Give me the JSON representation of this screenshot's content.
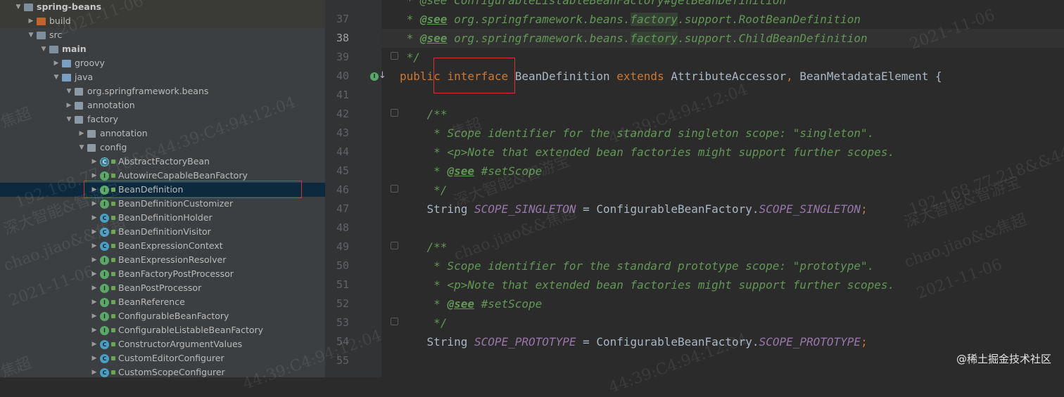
{
  "project_tree": {
    "rows": [
      {
        "label": "spring-beans",
        "icon": "module-icon",
        "expanded": true,
        "bold": true
      },
      {
        "label": "build",
        "icon": "folder-orange-icon",
        "expanded": false,
        "bold": false
      },
      {
        "label": "src",
        "icon": "folder-icon",
        "expanded": true,
        "bold": false
      },
      {
        "label": "main",
        "icon": "folder-icon",
        "expanded": true,
        "bold": true
      },
      {
        "label": "groovy",
        "icon": "folder-blue-icon",
        "expanded": false,
        "bold": false
      },
      {
        "label": "java",
        "icon": "folder-blue-icon",
        "expanded": true,
        "bold": false
      },
      {
        "label": "org.springframework.beans",
        "icon": "package-icon",
        "expanded": true,
        "bold": false
      },
      {
        "label": "annotation",
        "icon": "package-icon",
        "expanded": false,
        "bold": false
      },
      {
        "label": "factory",
        "icon": "package-icon",
        "expanded": true,
        "bold": false
      },
      {
        "label": "annotation",
        "icon": "package-icon",
        "expanded": false,
        "bold": false
      },
      {
        "label": "config",
        "icon": "package-icon",
        "expanded": true,
        "bold": false
      },
      {
        "label": "AbstractFactoryBean",
        "icon": "abstract-class-icon",
        "expanded": false,
        "bold": false
      },
      {
        "label": "AutowireCapableBeanFactory",
        "icon": "interface-icon",
        "expanded": false,
        "bold": false
      },
      {
        "label": "BeanDefinition",
        "icon": "interface-icon",
        "expanded": false,
        "bold": false,
        "selected": true
      },
      {
        "label": "BeanDefinitionCustomizer",
        "icon": "interface-icon",
        "expanded": false,
        "bold": false
      },
      {
        "label": "BeanDefinitionHolder",
        "icon": "class-icon",
        "expanded": false,
        "bold": false
      },
      {
        "label": "BeanDefinitionVisitor",
        "icon": "class-icon",
        "expanded": false,
        "bold": false
      },
      {
        "label": "BeanExpressionContext",
        "icon": "class-icon",
        "expanded": false,
        "bold": false
      },
      {
        "label": "BeanExpressionResolver",
        "icon": "interface-icon",
        "expanded": false,
        "bold": false
      },
      {
        "label": "BeanFactoryPostProcessor",
        "icon": "interface-icon",
        "expanded": false,
        "bold": false
      },
      {
        "label": "BeanPostProcessor",
        "icon": "interface-icon",
        "expanded": false,
        "bold": false
      },
      {
        "label": "BeanReference",
        "icon": "interface-icon",
        "expanded": false,
        "bold": false
      },
      {
        "label": "ConfigurableBeanFactory",
        "icon": "interface-icon",
        "expanded": false,
        "bold": false
      },
      {
        "label": "ConfigurableListableBeanFactory",
        "icon": "interface-icon",
        "expanded": false,
        "bold": false
      },
      {
        "label": "ConstructorArgumentValues",
        "icon": "class-icon",
        "expanded": false,
        "bold": false
      },
      {
        "label": "CustomEditorConfigurer",
        "icon": "class-icon",
        "expanded": false,
        "bold": false
      },
      {
        "label": "CustomScopeConfigurer",
        "icon": "class-icon",
        "expanded": false,
        "bold": false
      }
    ]
  },
  "editor": {
    "current_line": "38",
    "lines": [
      {
        "num": "37",
        "tokens": [
          {
            "t": " * ",
            "c": "doc"
          },
          {
            "t": "@see",
            "c": "tag"
          },
          {
            "t": " org.springframework.beans.",
            "c": "doc"
          },
          {
            "t": "factory",
            "c": "doc hl-fact"
          },
          {
            "t": ".support.RootBeanDefinition",
            "c": "doc"
          }
        ]
      },
      {
        "num": "38",
        "tokens": [
          {
            "t": " * ",
            "c": "doc"
          },
          {
            "t": "@see",
            "c": "tag"
          },
          {
            "t": " org.springframework.beans.",
            "c": "doc"
          },
          {
            "t": "factory",
            "c": "doc hl-fact"
          },
          {
            "t": ".support.ChildBeanDefinition",
            "c": "doc"
          }
        ]
      },
      {
        "num": "39",
        "tokens": [
          {
            "t": " */",
            "c": "doc"
          }
        ]
      },
      {
        "num": "40",
        "tokens": [
          {
            "t": "public ",
            "c": "kw"
          },
          {
            "t": "interface",
            "c": "kw"
          },
          {
            "t": " BeanDefinition ",
            "c": "ident"
          },
          {
            "t": "extends ",
            "c": "kw"
          },
          {
            "t": "AttributeAccessor",
            "c": "ident"
          },
          {
            "t": ", ",
            "c": "kw"
          },
          {
            "t": "BeanMetadataElement {",
            "c": "ident"
          }
        ]
      },
      {
        "num": "41",
        "tokens": []
      },
      {
        "num": "42",
        "tokens": [
          {
            "t": "    /**",
            "c": "doc"
          }
        ]
      },
      {
        "num": "43",
        "tokens": [
          {
            "t": "     * Scope identifier for the standard singleton scope: \"singleton\".",
            "c": "doc"
          }
        ]
      },
      {
        "num": "44",
        "tokens": [
          {
            "t": "     * <p>Note that extended bean factories might support further scopes.",
            "c": "doc"
          }
        ]
      },
      {
        "num": "45",
        "tokens": [
          {
            "t": "     * ",
            "c": "doc"
          },
          {
            "t": "@see",
            "c": "tag"
          },
          {
            "t": " #setScope",
            "c": "doc"
          }
        ]
      },
      {
        "num": "46",
        "tokens": [
          {
            "t": "     */",
            "c": "doc"
          }
        ]
      },
      {
        "num": "47",
        "tokens": [
          {
            "t": "    String ",
            "c": "ident"
          },
          {
            "t": "SCOPE_SINGLETON",
            "c": "const"
          },
          {
            "t": " = ConfigurableBeanFactory.",
            "c": "ident"
          },
          {
            "t": "SCOPE_SINGLETON",
            "c": "const"
          },
          {
            "t": ";",
            "c": "kw"
          }
        ]
      },
      {
        "num": "48",
        "tokens": []
      },
      {
        "num": "49",
        "tokens": [
          {
            "t": "    /**",
            "c": "doc"
          }
        ]
      },
      {
        "num": "50",
        "tokens": [
          {
            "t": "     * Scope identifier for the standard prototype scope: \"prototype\".",
            "c": "doc"
          }
        ]
      },
      {
        "num": "51",
        "tokens": [
          {
            "t": "     * <p>Note that extended bean factories might support further scopes.",
            "c": "doc"
          }
        ]
      },
      {
        "num": "52",
        "tokens": [
          {
            "t": "     * ",
            "c": "doc"
          },
          {
            "t": "@see",
            "c": "tag"
          },
          {
            "t": " #setScope",
            "c": "doc"
          }
        ]
      },
      {
        "num": "53",
        "tokens": [
          {
            "t": "     */",
            "c": "doc"
          }
        ]
      },
      {
        "num": "54",
        "tokens": [
          {
            "t": "    String ",
            "c": "ident"
          },
          {
            "t": "SCOPE_PROTOTYPE",
            "c": "const"
          },
          {
            "t": " = ConfigurableBeanFactory.",
            "c": "ident"
          },
          {
            "t": "SCOPE_PROTOTYPE",
            "c": "const"
          },
          {
            "t": ";",
            "c": "kw"
          }
        ]
      },
      {
        "num": "55",
        "tokens": []
      }
    ],
    "partial_top_line": " * @see ConfigurableListableBeanFactory#getBeanDefinition",
    "gutter_icon": "implemented-by-icon"
  },
  "watermarks": {
    "date": "2021-11-06",
    "ip": "192.168.77.218&&44:39:C4:94:12:04",
    "mac": "44:39:C4:94:12:04",
    "name": "焦超",
    "email": "chao.jiao&&焦超",
    "org": "深大智能&智游宝"
  },
  "credit": "@稀土掘金技术社区",
  "colors": {
    "selection": "#0d293e",
    "highlight_box": "#d8322c",
    "keyword": "#cc7832",
    "doc": "#629755"
  }
}
